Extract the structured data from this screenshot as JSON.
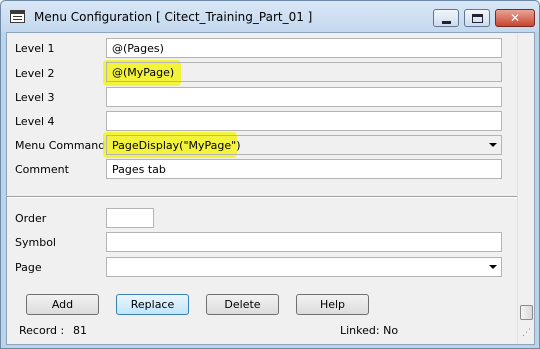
{
  "window": {
    "title": "Menu Configuration [ Citect_Training_Part_01 ]",
    "close_glyph": "✕"
  },
  "form": {
    "level1": {
      "label": "Level 1",
      "value": "@(Pages)"
    },
    "level2": {
      "label": "Level 2",
      "value": "@(MyPage)"
    },
    "level3": {
      "label": "Level 3",
      "value": ""
    },
    "level4": {
      "label": "Level 4",
      "value": ""
    },
    "menu_command": {
      "label": "Menu Command",
      "value": "PageDisplay(\"MyPage\")"
    },
    "comment": {
      "label": "Comment",
      "value": "Pages tab"
    },
    "order": {
      "label": "Order",
      "value": ""
    },
    "symbol": {
      "label": "Symbol",
      "value": ""
    },
    "page": {
      "label": "Page",
      "value": ""
    }
  },
  "buttons": {
    "add": "Add",
    "replace": "Replace",
    "delete": "Delete",
    "help": "Help"
  },
  "status": {
    "record_label": "Record :",
    "record_value": "81",
    "linked": "Linked: No"
  },
  "colors": {
    "highlight": "#f4f31c",
    "title_bar": "#c3d8ee",
    "close_button": "#c8452f"
  }
}
